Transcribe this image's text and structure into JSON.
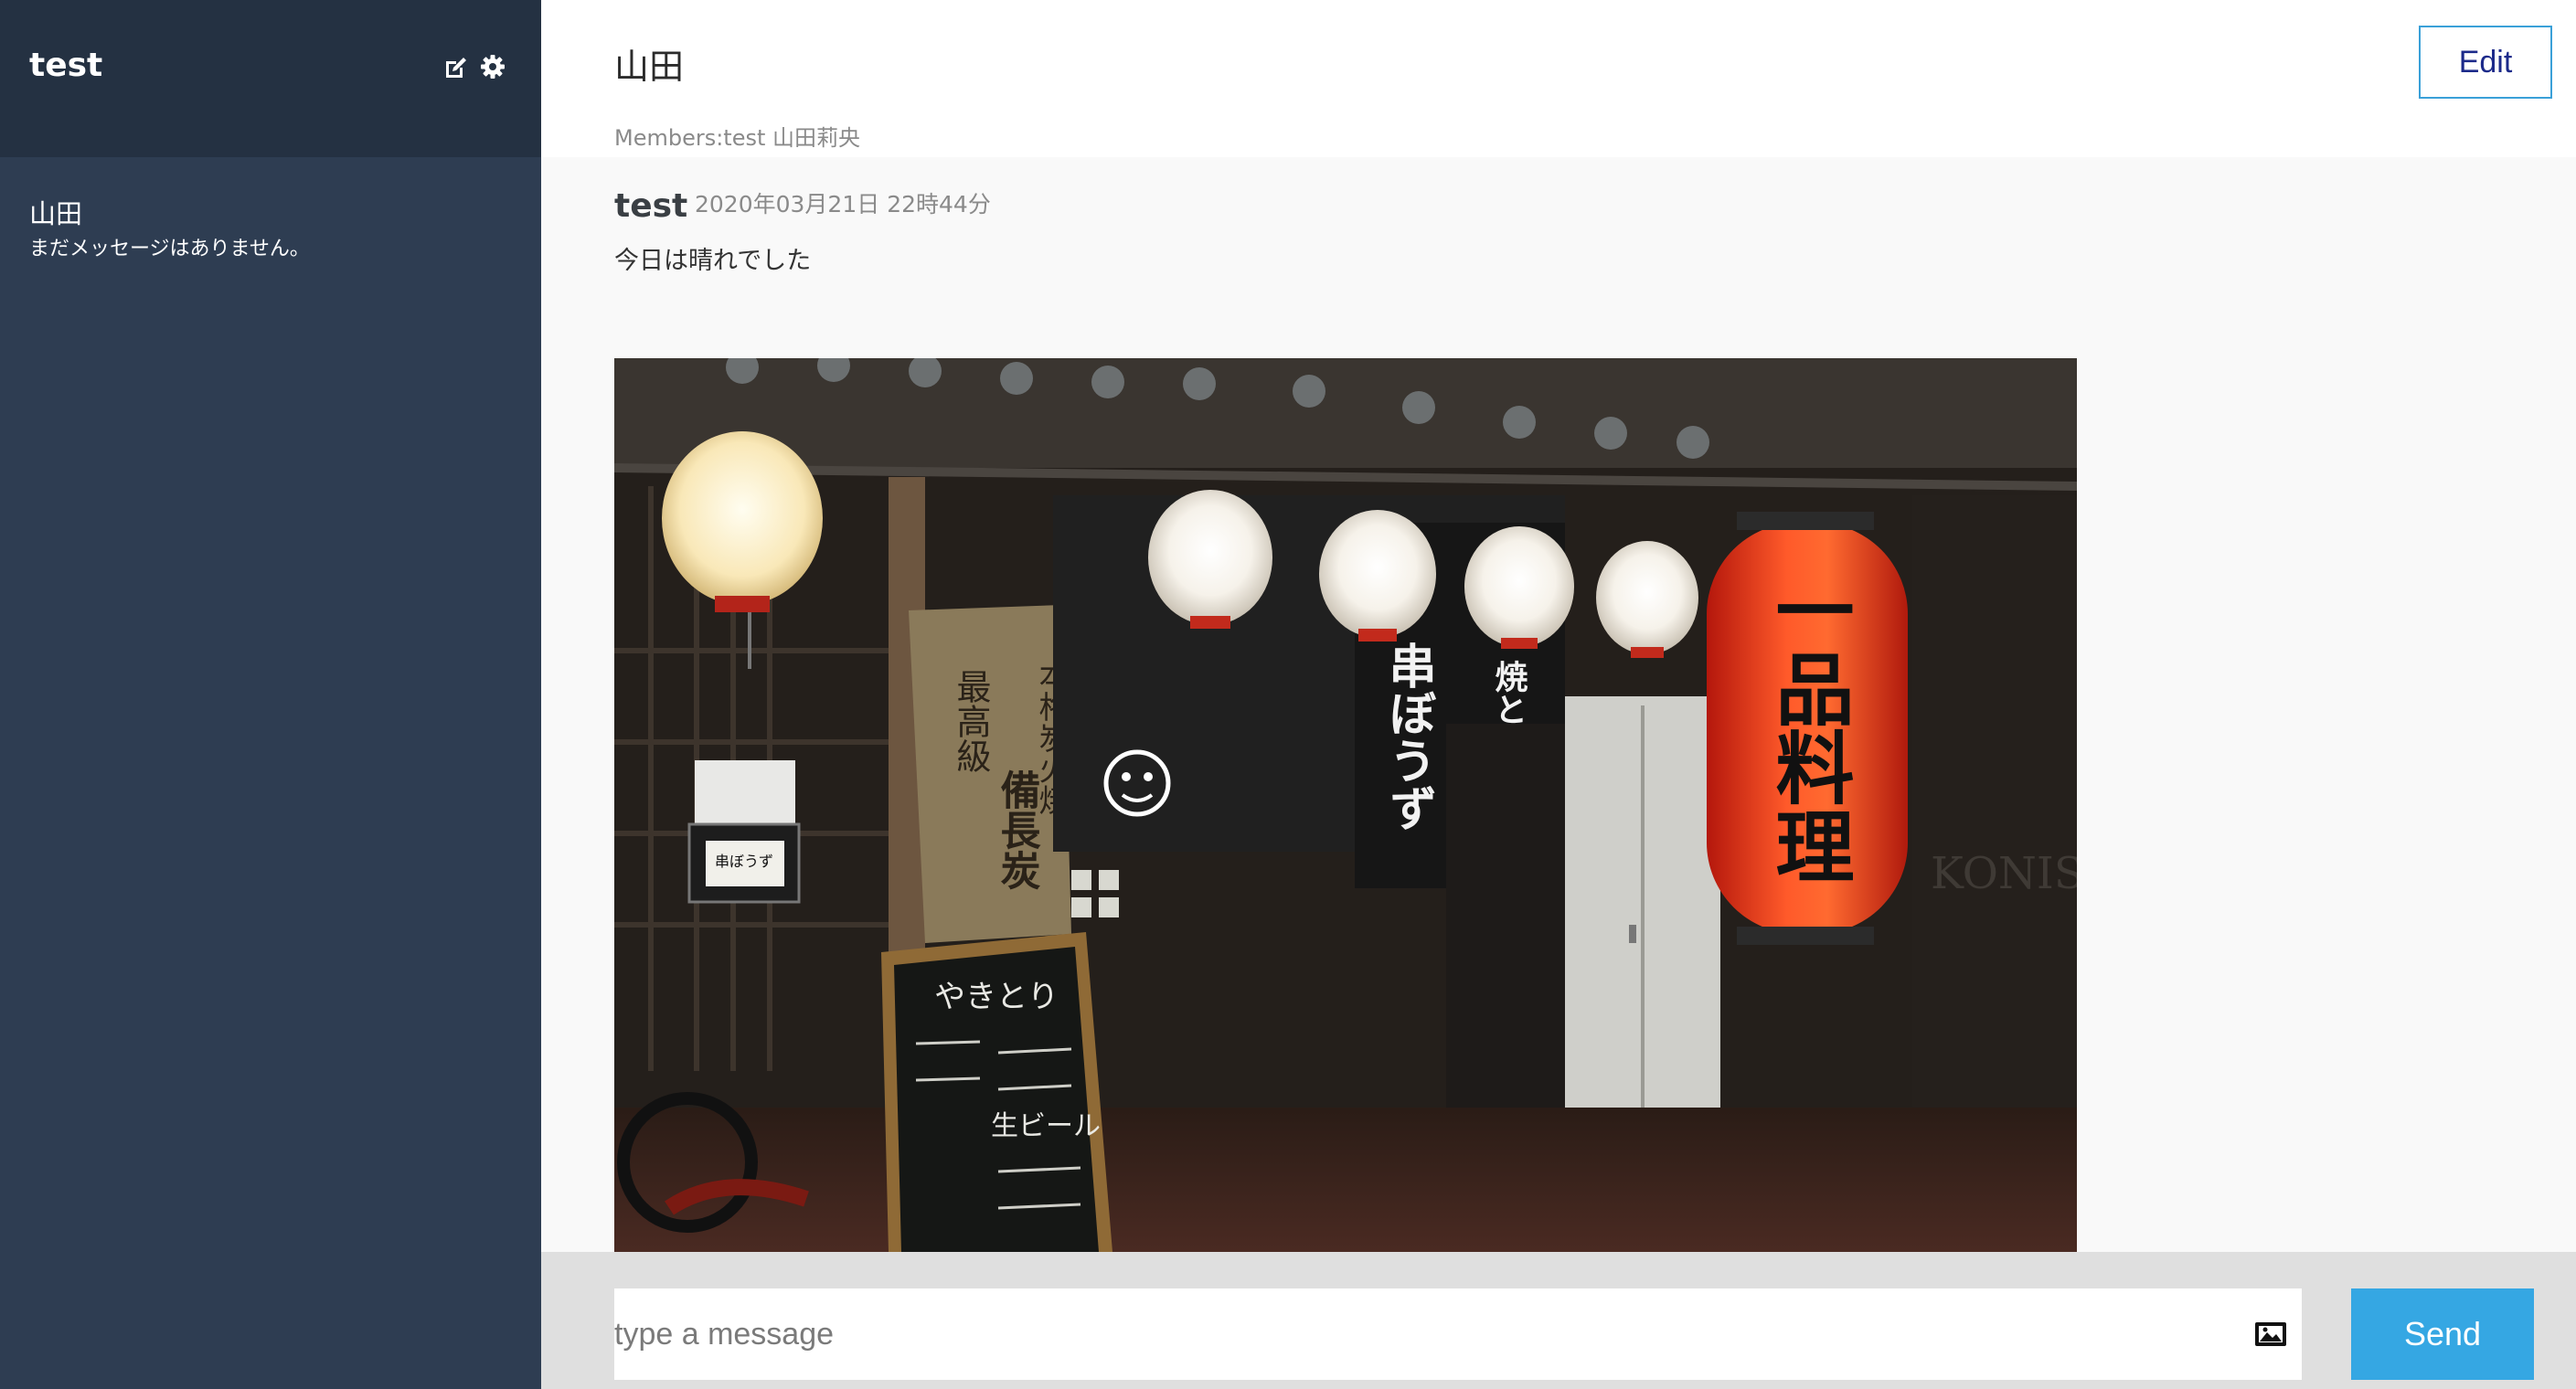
{
  "sidebar": {
    "app_name": "test",
    "icons": [
      "edit-icon",
      "gear-icon"
    ],
    "rooms": [
      {
        "name": "山田",
        "last_message": "まだメッセージはありません。"
      }
    ]
  },
  "room": {
    "title": "山田",
    "members": "Members:test 山田莉央",
    "edit_label": "Edit"
  },
  "messages": [
    {
      "author": "test",
      "timestamp": "2020年03月21日 22時44分",
      "text": "今日は晴れでした",
      "photo": {
        "signs": {
          "lantern_big": "一品料理",
          "noren_1": "串ぼうず",
          "noren_2": "焼とり",
          "wood_sign_left": "最高級",
          "wood_sign_mid": "備長炭",
          "wood_sign_right": "本格炭火焼",
          "blackboard_title": "やきとり",
          "blackboard_beer": "生ビール",
          "small_plate": "串ぼうず",
          "wall_text": "KONISO"
        }
      }
    }
  ],
  "composer": {
    "placeholder": "type a message",
    "send_label": "Send",
    "attach_icon": "image-icon"
  },
  "colors": {
    "sidebar_bg": "#2e3d52",
    "sidebar_header_bg": "#243142",
    "send_button": "#35a7e3",
    "edit_border": "#3aa0d8",
    "lantern_red": "#e0301e"
  }
}
